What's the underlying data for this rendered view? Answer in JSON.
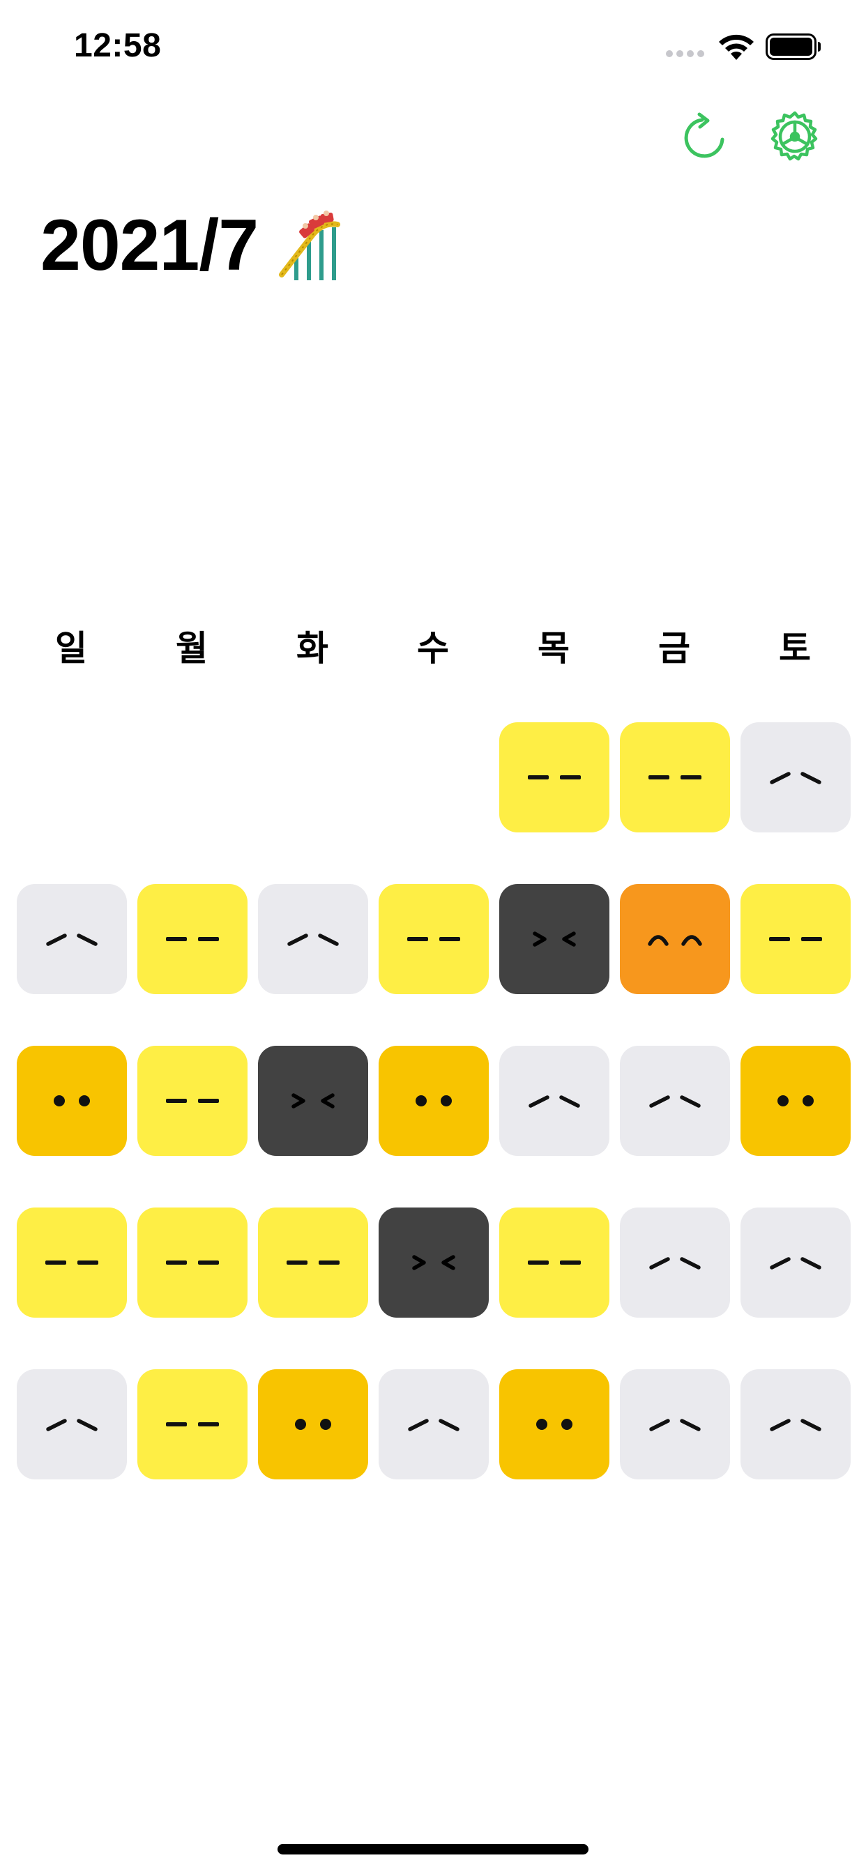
{
  "status_bar": {
    "time": "12:58",
    "signal_icon": "signal-dots-icon",
    "wifi_icon": "wifi-icon",
    "battery_icon": "battery-icon"
  },
  "toolbar": {
    "refresh_icon": "refresh-icon",
    "settings_icon": "gear-icon",
    "accent_color": "#3cc35f"
  },
  "header": {
    "title": "2021/7",
    "title_icon": "roller-coaster-icon"
  },
  "weekdays": [
    "일",
    "월",
    "화",
    "수",
    "목",
    "금",
    "토"
  ],
  "mood_colors": {
    "light": "#eaeaee",
    "yellow": "#feee45",
    "gold": "#f8c400",
    "orange": "#f7971d",
    "dark": "#424242"
  },
  "calendar": {
    "weeks": [
      [
        null,
        null,
        null,
        null,
        {
          "mood": "yellow",
          "face": "flat"
        },
        {
          "mood": "yellow",
          "face": "flat"
        },
        {
          "mood": "light",
          "face": "sad"
        }
      ],
      [
        {
          "mood": "light",
          "face": "sad"
        },
        {
          "mood": "yellow",
          "face": "flat"
        },
        {
          "mood": "light",
          "face": "sad"
        },
        {
          "mood": "yellow",
          "face": "flat"
        },
        {
          "mood": "dark",
          "face": "squint"
        },
        {
          "mood": "orange",
          "face": "happy"
        },
        {
          "mood": "yellow",
          "face": "flat"
        }
      ],
      [
        {
          "mood": "gold",
          "face": "dots"
        },
        {
          "mood": "yellow",
          "face": "flat"
        },
        {
          "mood": "dark",
          "face": "squint"
        },
        {
          "mood": "gold",
          "face": "dots"
        },
        {
          "mood": "light",
          "face": "sad"
        },
        {
          "mood": "light",
          "face": "sad"
        },
        {
          "mood": "gold",
          "face": "dots"
        }
      ],
      [
        {
          "mood": "yellow",
          "face": "flat"
        },
        {
          "mood": "yellow",
          "face": "flat"
        },
        {
          "mood": "yellow",
          "face": "flat"
        },
        {
          "mood": "dark",
          "face": "squint"
        },
        {
          "mood": "yellow",
          "face": "flat"
        },
        {
          "mood": "light",
          "face": "sad"
        },
        {
          "mood": "light",
          "face": "sad"
        }
      ],
      [
        {
          "mood": "light",
          "face": "sad"
        },
        {
          "mood": "yellow",
          "face": "flat"
        },
        {
          "mood": "gold",
          "face": "dots"
        },
        {
          "mood": "light",
          "face": "sad"
        },
        {
          "mood": "gold",
          "face": "dots"
        },
        {
          "mood": "light",
          "face": "sad"
        },
        {
          "mood": "light",
          "face": "sad"
        }
      ]
    ]
  }
}
